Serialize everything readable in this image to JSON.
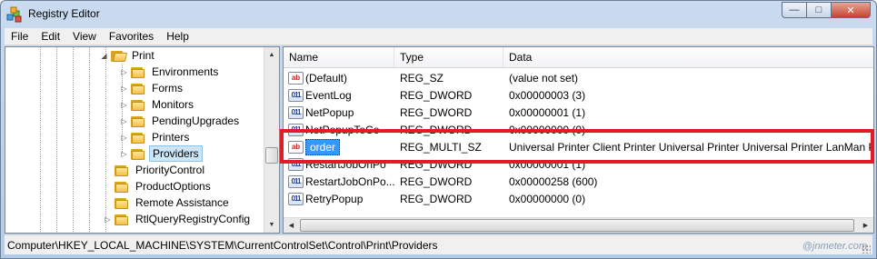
{
  "window": {
    "title": "Registry Editor",
    "controls": {
      "minimize": "—",
      "maximize": "□",
      "close": "✕"
    }
  },
  "menu": [
    "File",
    "Edit",
    "View",
    "Favorites",
    "Help"
  ],
  "tree": {
    "items": [
      {
        "label": "Print",
        "expanded": true,
        "expander": "◢"
      },
      {
        "label": "Environments",
        "expander": "▷"
      },
      {
        "label": "Forms",
        "expander": "▷"
      },
      {
        "label": "Monitors",
        "expander": "▷"
      },
      {
        "label": "PendingUpgrades",
        "expander": "▷"
      },
      {
        "label": "Printers",
        "expander": "▷"
      },
      {
        "label": "Providers",
        "expander": "▷",
        "selected": true
      },
      {
        "label": "PriorityControl",
        "expander": ""
      },
      {
        "label": "ProductOptions",
        "expander": ""
      },
      {
        "label": "Remote Assistance",
        "expander": ""
      },
      {
        "label": "RtlQueryRegistryConfig",
        "expander": "▷"
      }
    ]
  },
  "values": {
    "columns": [
      "Name",
      "Type",
      "Data"
    ],
    "rows": [
      {
        "icon": "string-value-icon",
        "name": "(Default)",
        "type": "REG_SZ",
        "data": "(value not set)"
      },
      {
        "icon": "binary-value-icon",
        "name": "EventLog",
        "type": "REG_DWORD",
        "data": "0x00000003 (3)"
      },
      {
        "icon": "binary-value-icon",
        "name": "NetPopup",
        "type": "REG_DWORD",
        "data": "0x00000001 (1)"
      },
      {
        "icon": "binary-value-icon",
        "name": "NetPopupToCo",
        "type": "REG_DWORD",
        "data": "0x00000000 (0)"
      },
      {
        "icon": "string-value-icon",
        "name": "order",
        "type": "REG_MULTI_SZ",
        "data": "Universal Printer Client Printer Universal Printer Universal Printer LanMan Pr",
        "selected": true
      },
      {
        "icon": "binary-value-icon",
        "name": "RestartJobOnPo",
        "type": "REG_DWORD",
        "data": "0x00000001 (1)"
      },
      {
        "icon": "binary-value-icon",
        "name": "RestartJobOnPo...",
        "type": "REG_DWORD",
        "data": "0x00000258 (600)"
      },
      {
        "icon": "binary-value-icon",
        "name": "RetryPopup",
        "type": "REG_DWORD",
        "data": "0x00000000 (0)"
      }
    ]
  },
  "icons": {
    "string": "ab",
    "binary": "011"
  },
  "statusbar": {
    "path": "Computer\\HKEY_LOCAL_MACHINE\\SYSTEM\\CurrentControlSet\\Control\\Print\\Providers"
  },
  "watermark": "@jnmeter.com",
  "colors": {
    "highlight": "#e21b27",
    "selection": "#3399ff"
  }
}
